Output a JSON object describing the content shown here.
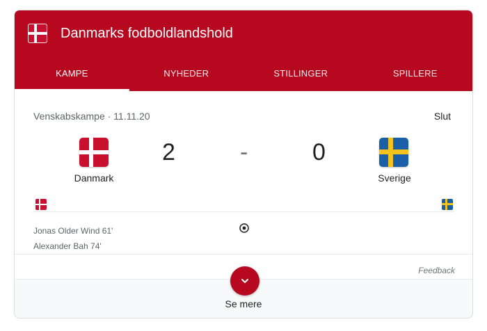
{
  "header": {
    "title": "Danmarks fodboldlandshold",
    "flag_icon": "denmark-flag-icon"
  },
  "tabs": [
    {
      "label": "KAMPE",
      "active": true
    },
    {
      "label": "NYHEDER",
      "active": false
    },
    {
      "label": "STILLINGER",
      "active": false
    },
    {
      "label": "SPILLERE",
      "active": false
    }
  ],
  "match": {
    "competition_date": "Venskabskampe · 11.11.20",
    "status": "Slut",
    "home": {
      "name": "Danmark",
      "score": "2",
      "flag": "denmark-flag-icon"
    },
    "away": {
      "name": "Sverige",
      "score": "0",
      "flag": "sweden-flag-icon"
    },
    "separator": "-",
    "scorers": [
      "Jonas Older Wind 61'",
      "Alexander Bah 74'"
    ],
    "goal_icon": "soccer-ball-icon"
  },
  "feedback_label": "Feedback",
  "more": {
    "label": "Se mere",
    "icon": "chevron-down-icon"
  },
  "colors": {
    "brand_red": "#b6091f",
    "denmark_red": "#c8102e",
    "sweden_blue": "#1a5fa8",
    "sweden_yellow": "#f3c21b"
  }
}
